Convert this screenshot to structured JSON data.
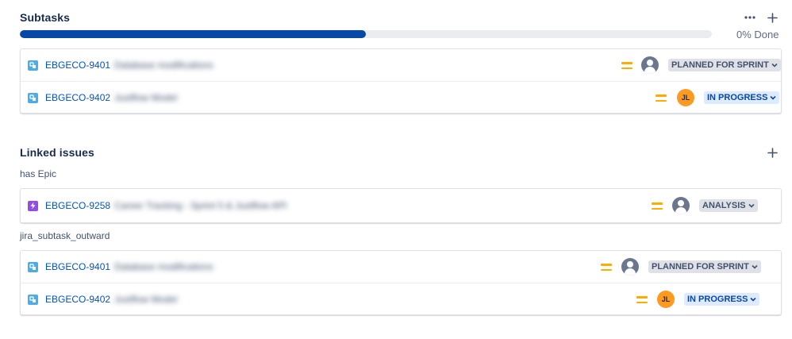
{
  "subtasks": {
    "title": "Subtasks",
    "progress": {
      "percent_fill": 0.5,
      "label": "0% Done"
    },
    "items": [
      {
        "key": "EBGECO-9401",
        "summary": "Database modifications",
        "avatar": "unassigned-avatar",
        "status": "PLANNED FOR SPRINT"
      },
      {
        "key": "EBGECO-9402",
        "summary": "Justflow Model",
        "avatar": "JL",
        "status": "IN PROGRESS"
      }
    ]
  },
  "linked": {
    "title": "Linked issues",
    "groups": [
      {
        "label": "has Epic",
        "items": [
          {
            "key": "EBGECO-9258",
            "summary": "Career Tracking - Sprint 5 & Justflow API",
            "avatar": "unassigned-avatar",
            "status": "ANALYSIS"
          }
        ]
      },
      {
        "label": "jira_subtask_outward",
        "items": [
          {
            "key": "EBGECO-9401",
            "summary": "Database modifications",
            "avatar": "unassigned-avatar",
            "status": "PLANNED FOR SPRINT"
          },
          {
            "key": "EBGECO-9402",
            "summary": "Justflow Model",
            "avatar": "JL",
            "status": "IN PROGRESS"
          }
        ]
      }
    ]
  },
  "icons": {
    "more": "more-horizontal-icon",
    "add": "add-icon",
    "subtask": "subtask-icon",
    "epic": "epic-icon",
    "priority": "priority-medium-icon",
    "chevron": "chevron-down-icon"
  },
  "colors": {
    "progress_fill": "#0747a6",
    "link": "#0052cc",
    "priority": "#ffab00",
    "avatar_jl": "#ff991f",
    "status_grey_bg": "#dfe1e6",
    "status_blue_bg": "#deebff",
    "status_blue_text": "#0747a6"
  }
}
